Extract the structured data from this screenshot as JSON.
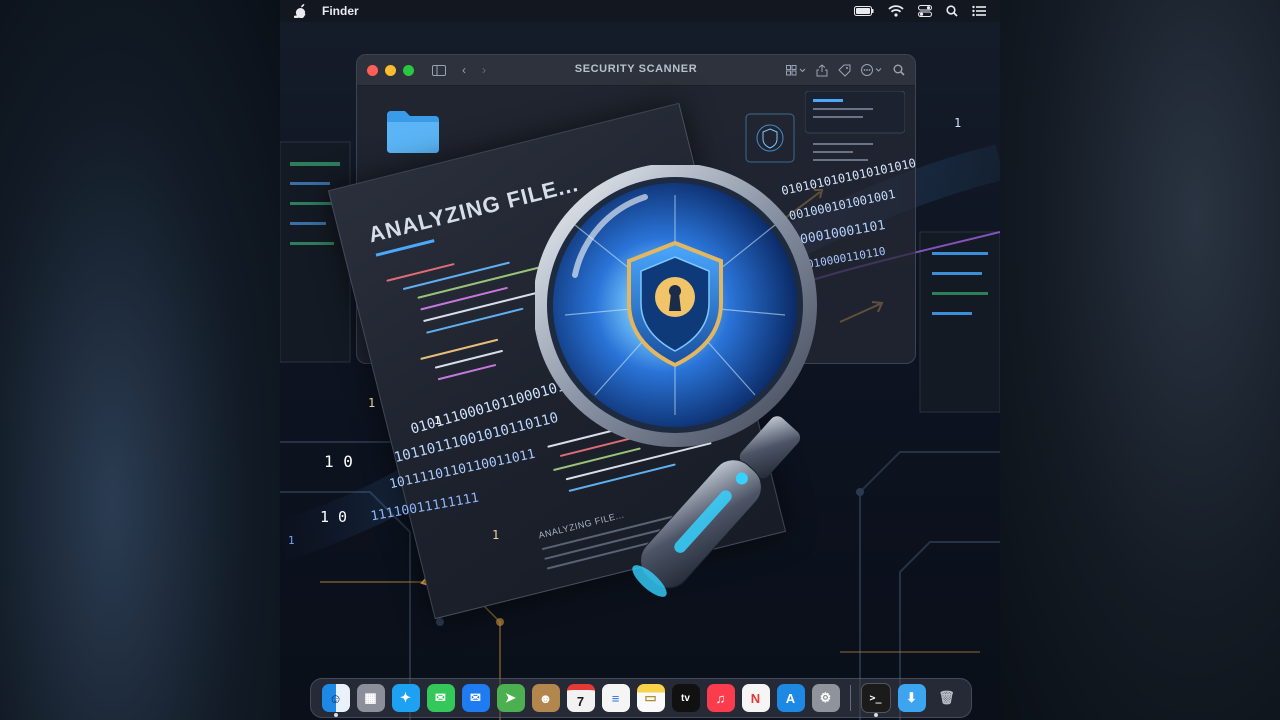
{
  "menubar": {
    "app_name": "Finder",
    "icons": [
      "apple-icon",
      "battery-icon",
      "wifi-icon",
      "control-center-icon",
      "search-icon",
      "notification-center-icon"
    ]
  },
  "window": {
    "title": "SECURITY SCANNER",
    "toolbar_icons": [
      "sidebar-toggle-icon",
      "back-icon",
      "forward-icon",
      "view-options-icon",
      "share-icon",
      "tag-icon",
      "more-icon",
      "search-icon"
    ]
  },
  "document": {
    "heading": "ANALYZING FILE...",
    "footer_text": "ANALYZING FILE..."
  },
  "binary": {
    "stream_left_1": "0101110001011000101",
    "stream_left_2": "10110111001010110110",
    "stream_left_3": "1011110110110011011",
    "stream_left_4": "11110011111111",
    "stream_right_1": "0101010101010101010",
    "stream_right_2": "001000101001001",
    "stream_right_3": "000010001101",
    "stream_right_4": "0010000110110",
    "digits": [
      "1",
      "0",
      "1",
      "1 0",
      "1 0",
      "1",
      "0",
      "1",
      "1"
    ]
  },
  "dock": {
    "items": [
      {
        "name": "finder",
        "glyph": "☺",
        "color": "#1e88e5"
      },
      {
        "name": "launchpad",
        "glyph": "▦",
        "color": "#8a8f99"
      },
      {
        "name": "safari",
        "glyph": "✦",
        "color": "#1da1f2"
      },
      {
        "name": "messages",
        "glyph": "✉",
        "color": "#34c759"
      },
      {
        "name": "mail",
        "glyph": "✉",
        "color": "#1e7bf0"
      },
      {
        "name": "maps",
        "glyph": "➤",
        "color": "#4caf50"
      },
      {
        "name": "contacts",
        "glyph": "☻",
        "color": "#b3864e"
      },
      {
        "name": "calendar",
        "glyph": "7",
        "color": "#f2f2f2"
      },
      {
        "name": "reminders",
        "glyph": "≡",
        "color": "#f5f5f5"
      },
      {
        "name": "notes",
        "glyph": "▭",
        "color": "#f7d24a"
      },
      {
        "name": "apple-tv",
        "glyph": "tv",
        "color": "#111111"
      },
      {
        "name": "music",
        "glyph": "♫",
        "color": "#fa3c4c"
      },
      {
        "name": "news",
        "glyph": "N",
        "color": "#f5f5f5"
      },
      {
        "name": "app-store",
        "glyph": "A",
        "color": "#1e88e5"
      },
      {
        "name": "system-settings",
        "glyph": "⚙",
        "color": "#8e939c"
      }
    ],
    "right_items": [
      {
        "name": "terminal",
        "glyph": ">_",
        "color": "#1b1b1b"
      },
      {
        "name": "downloads-folder",
        "glyph": "⬇",
        "color": "#3da4f0"
      },
      {
        "name": "trash",
        "glyph": "🗑",
        "color": "#5b606a"
      }
    ]
  }
}
